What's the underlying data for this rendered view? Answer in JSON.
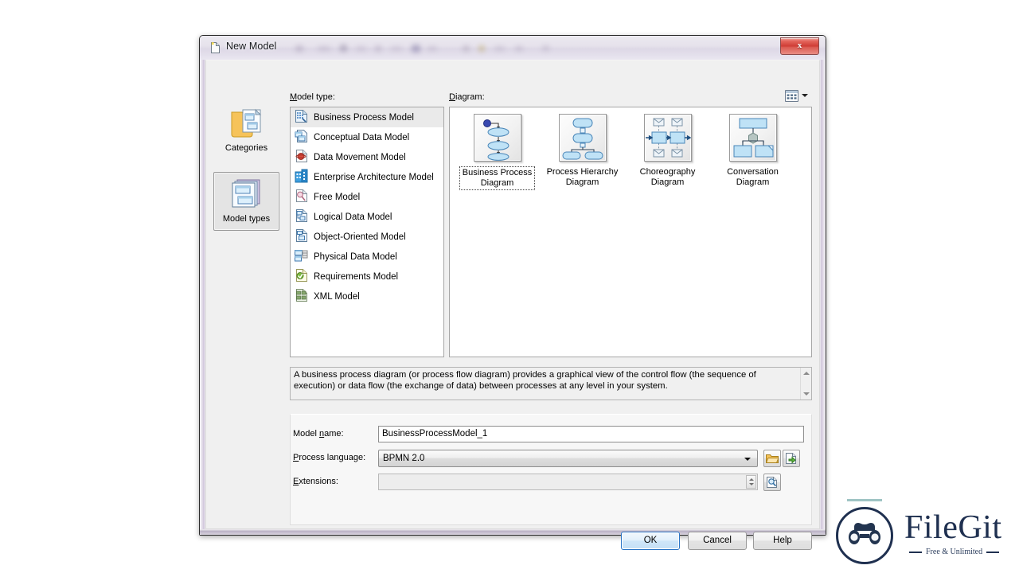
{
  "window": {
    "title": "New Model",
    "icon": "new-document-icon",
    "close_label": "x"
  },
  "rail": {
    "items": [
      {
        "label": "Categories",
        "icon": "folder-documents-icon",
        "selected": false
      },
      {
        "label": "Model types",
        "icon": "stacked-windows-icon",
        "selected": true
      }
    ]
  },
  "model_type": {
    "label_prefix": "M",
    "label_rest": "odel type:",
    "items": [
      {
        "label": "Business Process Model",
        "icon": "business-process-model-icon",
        "selected": true
      },
      {
        "label": "Conceptual Data Model",
        "icon": "conceptual-data-model-icon",
        "selected": false
      },
      {
        "label": "Data Movement Model",
        "icon": "data-movement-model-icon",
        "selected": false
      },
      {
        "label": "Enterprise Architecture Model",
        "icon": "enterprise-architecture-model-icon",
        "selected": false
      },
      {
        "label": "Free Model",
        "icon": "free-model-icon",
        "selected": false
      },
      {
        "label": "Logical Data Model",
        "icon": "logical-data-model-icon",
        "selected": false
      },
      {
        "label": "Object-Oriented Model",
        "icon": "object-oriented-model-icon",
        "selected": false
      },
      {
        "label": "Physical Data Model",
        "icon": "physical-data-model-icon",
        "selected": false
      },
      {
        "label": "Requirements Model",
        "icon": "requirements-model-icon",
        "selected": false
      },
      {
        "label": "XML Model",
        "icon": "xml-model-icon",
        "selected": false
      }
    ]
  },
  "diagram": {
    "label_prefix": "D",
    "label_rest": "iagram:",
    "view_toggle_icon": "list-view-icon",
    "items": [
      {
        "line1": "Business Process",
        "line2": "Diagram",
        "thumb": "business-process-diagram-thumb",
        "selected": true
      },
      {
        "line1": "Process Hierarchy",
        "line2": "Diagram",
        "thumb": "process-hierarchy-diagram-thumb",
        "selected": false
      },
      {
        "line1": "Choreography",
        "line2": "Diagram",
        "thumb": "choreography-diagram-thumb",
        "selected": false
      },
      {
        "line1": "Conversation",
        "line2": "Diagram",
        "thumb": "conversation-diagram-thumb",
        "selected": false
      }
    ]
  },
  "description": {
    "text": "A business process diagram (or process flow diagram) provides a graphical view of the control flow (the sequence of execution) or data flow (the exchange of data) between processes at any level in your system."
  },
  "form": {
    "model_name": {
      "label_a": "Model ",
      "label_u": "n",
      "label_b": "ame:",
      "value": "BusinessProcessModel_1"
    },
    "process_language": {
      "label_u": "P",
      "label_b": "rocess language:",
      "value": "BPMN 2.0",
      "browse_icon": "folder-open-icon",
      "import_icon": "document-import-icon"
    },
    "extensions": {
      "label_u": "E",
      "label_b": "xtensions:",
      "value": "",
      "browse_icon": "magnifier-document-icon"
    }
  },
  "buttons": {
    "ok": "OK",
    "cancel": "Cancel",
    "help": "Help"
  },
  "watermark": {
    "name": "FileGit",
    "tagline": "Free & Unlimited",
    "icon": "binoculars-icon",
    "color": "#1f3050"
  }
}
